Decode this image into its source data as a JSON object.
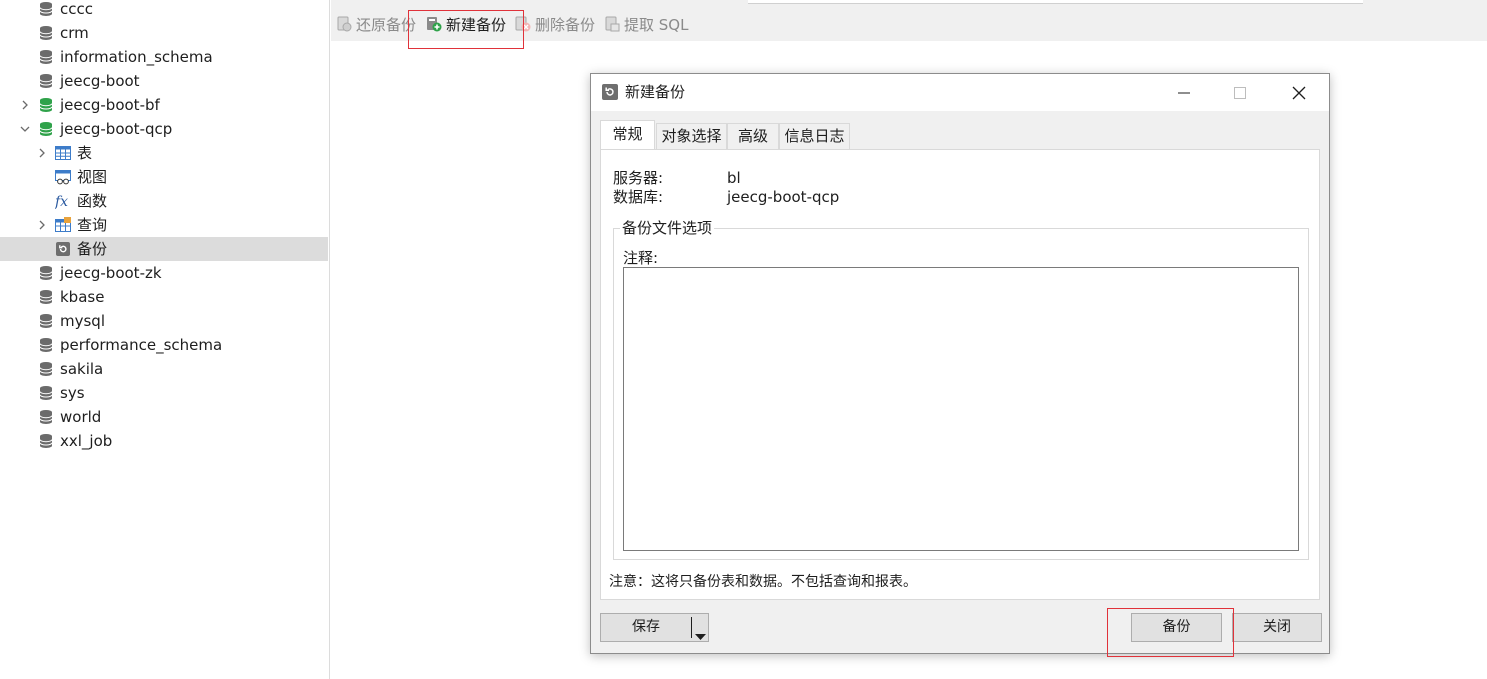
{
  "sidebar": {
    "items": [
      {
        "label": "cccc",
        "icon": "database-icon",
        "connected": false
      },
      {
        "label": "crm",
        "icon": "database-icon",
        "connected": false
      },
      {
        "label": "information_schema",
        "icon": "database-icon",
        "connected": false
      },
      {
        "label": "jeecg-boot",
        "icon": "database-icon",
        "connected": false
      },
      {
        "label": "jeecg-boot-bf",
        "icon": "database-icon",
        "connected": true,
        "expander": "collapsed"
      },
      {
        "label": "jeecg-boot-qcp",
        "icon": "database-icon",
        "connected": true,
        "expander": "expanded"
      },
      {
        "label": "表",
        "icon": "table-icon",
        "expander": "collapsed",
        "child": true
      },
      {
        "label": "视图",
        "icon": "view-icon",
        "child": true
      },
      {
        "label": "函数",
        "icon": "function-icon",
        "child": true
      },
      {
        "label": "查询",
        "icon": "query-icon",
        "expander": "collapsed",
        "child": true
      },
      {
        "label": "备份",
        "icon": "backup-icon",
        "child": true,
        "selected": true
      },
      {
        "label": "jeecg-boot-zk",
        "icon": "database-icon",
        "connected": false
      },
      {
        "label": "kbase",
        "icon": "database-icon",
        "connected": false
      },
      {
        "label": "mysql",
        "icon": "database-icon",
        "connected": false
      },
      {
        "label": "performance_schema",
        "icon": "database-icon",
        "connected": false
      },
      {
        "label": "sakila",
        "icon": "database-icon",
        "connected": false
      },
      {
        "label": "sys",
        "icon": "database-icon",
        "connected": false
      },
      {
        "label": "world",
        "icon": "database-icon",
        "connected": false
      },
      {
        "label": "xxl_job",
        "icon": "database-icon",
        "connected": false
      }
    ]
  },
  "toolbar": {
    "restore_label": "还原备份",
    "new_label": "新建备份",
    "delete_label": "删除备份",
    "extract_label": "提取 SQL"
  },
  "dialog": {
    "title": "新建备份",
    "tabs": [
      "常规",
      "对象选择",
      "高级",
      "信息日志"
    ],
    "active_tab": "常规",
    "server_label": "服务器:",
    "server_value": "bl",
    "database_label": "数据库:",
    "database_value": "jeecg-boot-qcp",
    "group_title": "备份文件选项",
    "comment_label": "注释:",
    "comment_value": "",
    "note": "注意：这将只备份表和数据。不包括查询和报表。",
    "save_label": "保存",
    "backup_label": "备份",
    "close_label": "关闭"
  },
  "colors": {
    "db_connected": "#2fa24a",
    "db_disconnected": "#6b6b6b",
    "highlight": "#e0323a",
    "selected_row": "#dcdcdc"
  }
}
